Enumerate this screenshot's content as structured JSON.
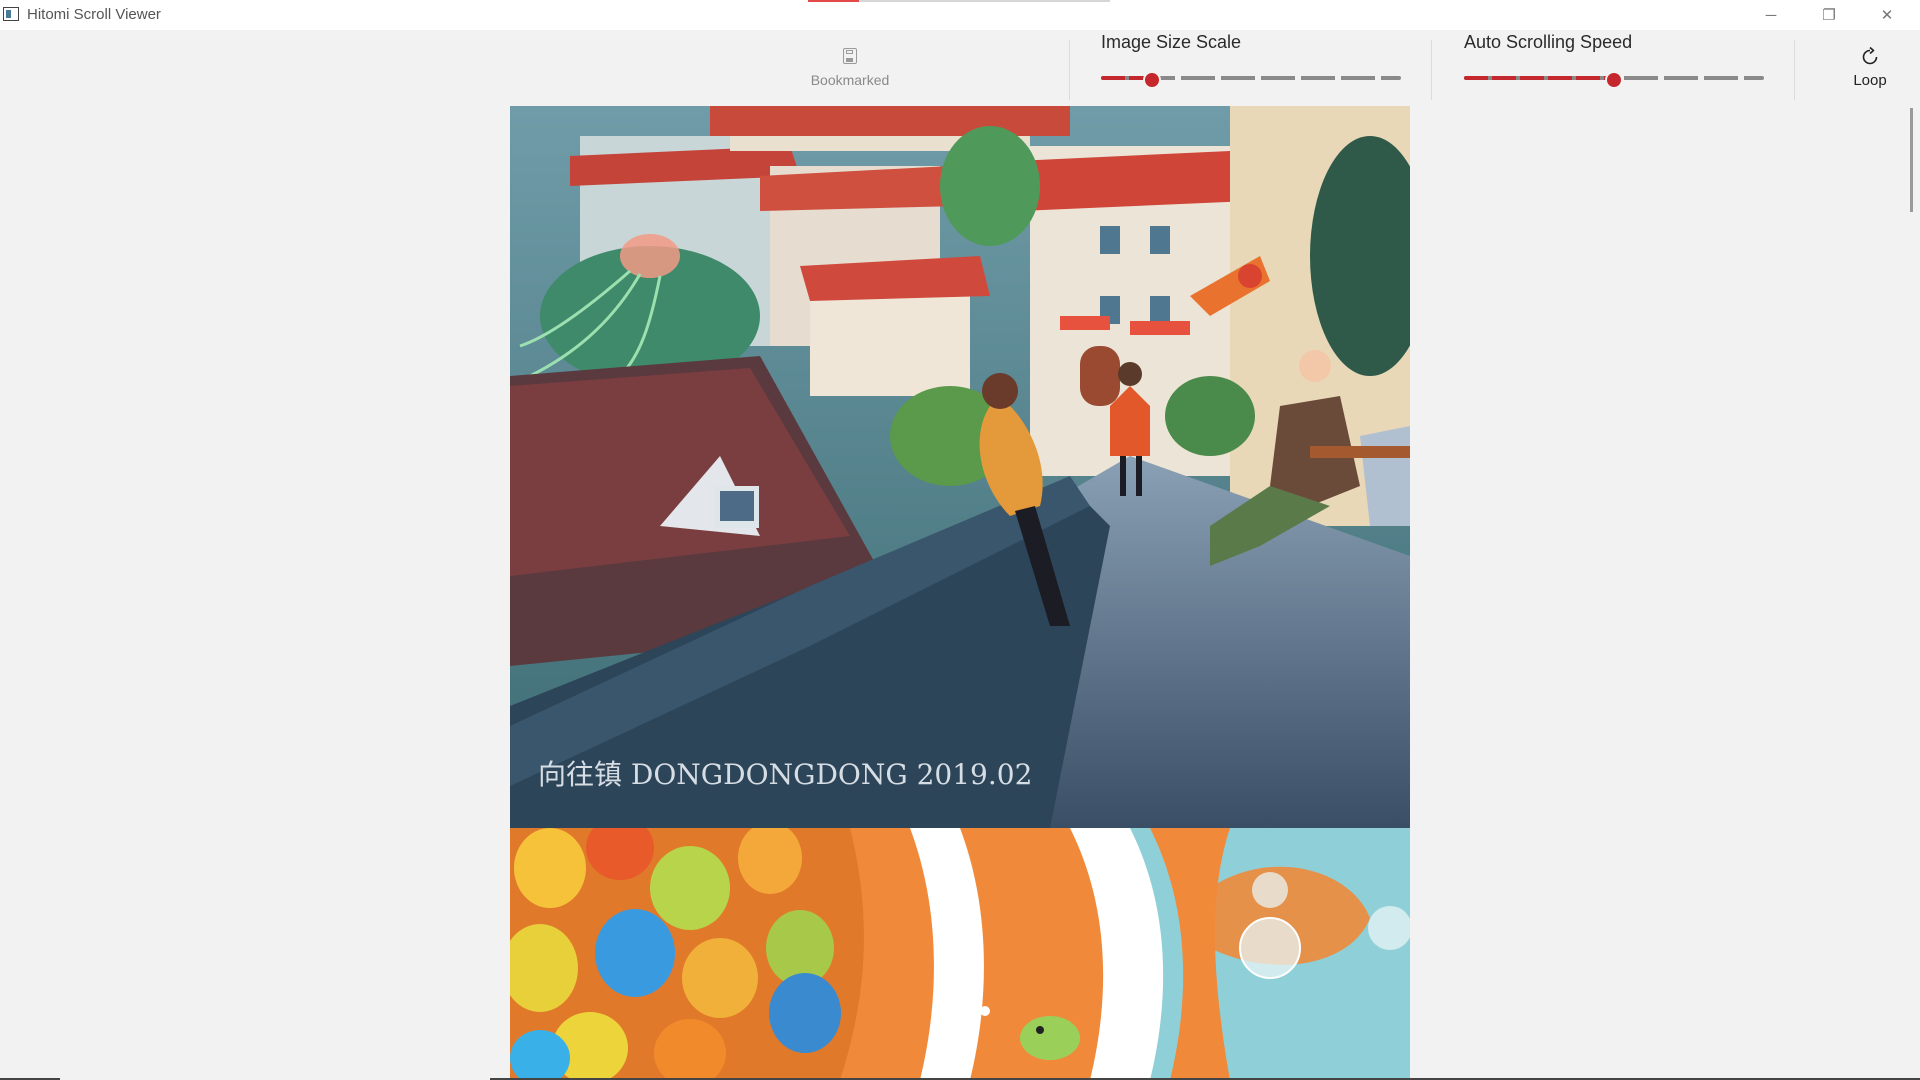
{
  "window": {
    "title": "Hitomi Scroll Viewer",
    "icon": "app-icon",
    "minimize_glyph": "─",
    "maximize_glyph": "❐",
    "close_glyph": "✕",
    "page_progress": 0.17
  },
  "toolbar": {
    "bookmark": {
      "label": "Bookmarked",
      "icon": "save-icon",
      "enabled": false
    },
    "image_size_scale": {
      "label": "Image Size Scale",
      "value": 0.17
    },
    "auto_scrolling_speed": {
      "label": "Auto Scrolling Speed",
      "value": 0.5
    },
    "loop": {
      "label": "Loop",
      "icon": "loop-icon"
    }
  },
  "images": [
    {
      "description": "watercolor town street illustration",
      "signature_text": "向往镇 DONGDONGDONG 2019.02"
    },
    {
      "description": "colorful balloons and clownfish illustration"
    }
  ],
  "colors": {
    "accent": "#c4272c",
    "progress": "#e24a4a",
    "background": "#f2f2f2"
  }
}
